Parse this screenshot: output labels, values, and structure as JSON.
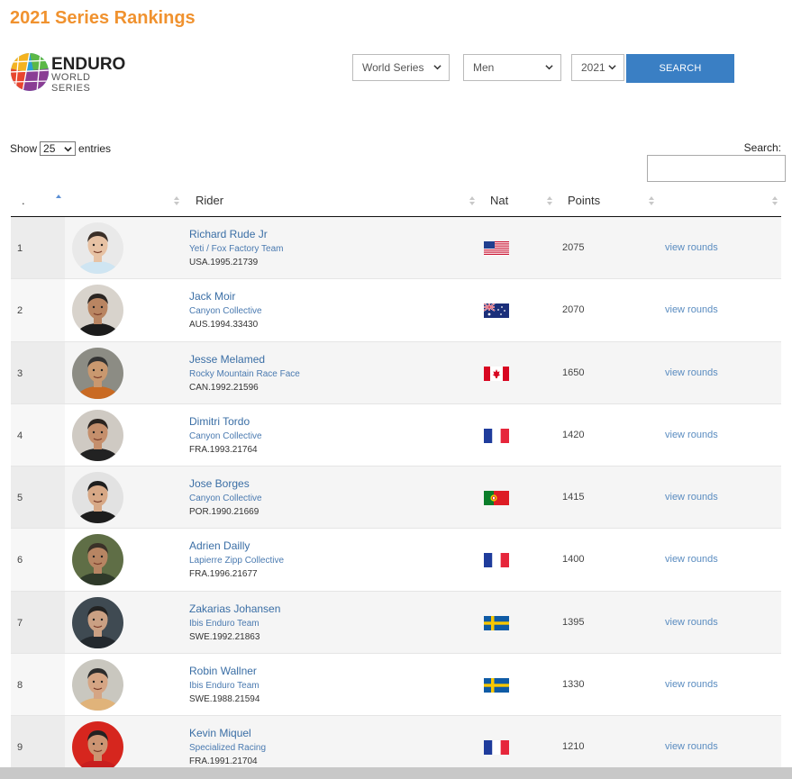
{
  "page_title": "2021 Series Rankings",
  "logo": {
    "word": "ENDURO",
    "sub": "WORLD SERIES"
  },
  "filters": {
    "series": "World Series",
    "gender": "Men",
    "year": "2021",
    "search_button": "SEARCH"
  },
  "controls": {
    "show_label": "Show",
    "entries_value": "25",
    "entries_label": "entries",
    "search_label": "Search:"
  },
  "table": {
    "headers": {
      "rank": ".",
      "photo": "",
      "rider": "Rider",
      "nat": "Nat",
      "points": "Points",
      "actions": ""
    },
    "rows": [
      {
        "rank": "1",
        "name": "Richard Rude Jr",
        "team": "Yeti / Fox Factory Team",
        "id": "USA.1995.21739",
        "nat": "USA",
        "points": "2075",
        "action": "view rounds",
        "skin": "#e7c2a4",
        "hair": "#3a2f28",
        "bg": "#e9e9e9",
        "shirt": "#cfe5f2"
      },
      {
        "rank": "2",
        "name": "Jack Moir",
        "team": "Canyon Collective",
        "id": "AUS.1994.33430",
        "nat": "AUS",
        "points": "2070",
        "action": "view rounds",
        "skin": "#b98562",
        "hair": "#2a2522",
        "bg": "#d8d3cc",
        "shirt": "#1c1c1c"
      },
      {
        "rank": "3",
        "name": "Jesse Melamed",
        "team": "Rocky Mountain Race Face",
        "id": "CAN.1992.21596",
        "nat": "CAN",
        "points": "1650",
        "action": "view rounds",
        "skin": "#c9986f",
        "hair": "#333333",
        "bg": "#8c8c84",
        "shirt": "#c96a23"
      },
      {
        "rank": "4",
        "name": "Dimitri Tordo",
        "team": "Canyon Collective",
        "id": "FRA.1993.21764",
        "nat": "FRA",
        "points": "1420",
        "action": "view rounds",
        "skin": "#c58f6c",
        "hair": "#2b2420",
        "bg": "#cfcac3",
        "shirt": "#222222"
      },
      {
        "rank": "5",
        "name": "Jose Borges",
        "team": "Canyon Collective",
        "id": "POR.1990.21669",
        "nat": "POR",
        "points": "1415",
        "action": "view rounds",
        "skin": "#d7a886",
        "hair": "#1e1e1e",
        "bg": "#e2e2e2",
        "shirt": "#1d1d1d"
      },
      {
        "rank": "6",
        "name": "Adrien Dailly",
        "team": "Lapierre Zipp Collective",
        "id": "FRA.1996.21677",
        "nat": "FRA",
        "points": "1400",
        "action": "view rounds",
        "skin": "#b78563",
        "hair": "#3a3128",
        "bg": "#5f6e46",
        "shirt": "#2f3a2a"
      },
      {
        "rank": "7",
        "name": "Zakarias Johansen",
        "team": "Ibis Enduro Team",
        "id": "SWE.1992.21863",
        "nat": "SWE",
        "points": "1395",
        "action": "view rounds",
        "skin": "#caa083",
        "hair": "#222222",
        "bg": "#3f4a52",
        "shirt": "#23292e"
      },
      {
        "rank": "8",
        "name": "Robin Wallner",
        "team": "Ibis Enduro Team",
        "id": "SWE.1988.21594",
        "nat": "SWE",
        "points": "1330",
        "action": "view rounds",
        "skin": "#d5a584",
        "hair": "#2c2c2c",
        "bg": "#c9c7bf",
        "shirt": "#e0b37a"
      },
      {
        "rank": "9",
        "name": "Kevin Miquel",
        "team": "Specialized Racing",
        "id": "FRA.1991.21704",
        "nat": "FRA",
        "points": "1210",
        "action": "view rounds",
        "skin": "#cc9472",
        "hair": "#222222",
        "bg": "#d6261e",
        "shirt": "#c81e1e"
      }
    ]
  }
}
